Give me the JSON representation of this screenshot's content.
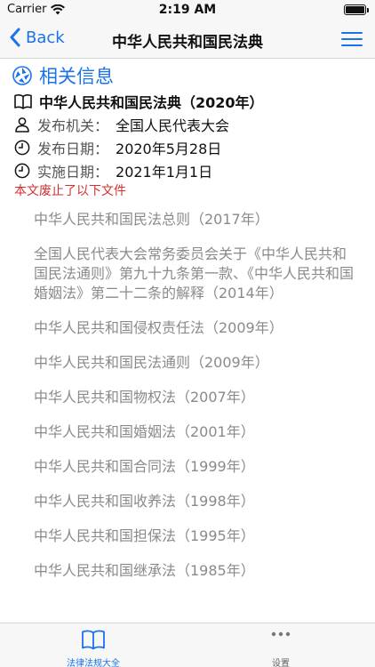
{
  "status_bar": {
    "carrier": "Carrier",
    "time": "2:19 AM",
    "battery_level": 1.0
  },
  "nav": {
    "back_label": "Back",
    "title": "中华人民共和国民法典",
    "menu_icon": "hamburger-menu-icon"
  },
  "section": {
    "title": "相关信息",
    "icon": "aperture-icon",
    "doc_title": "中华人民共和国民法典（2020年）",
    "issuer_label": "发布机关：",
    "issuer_value": "全国人民代表大会",
    "publish_label": "发布日期：",
    "publish_value": "2020年5月28日",
    "effective_label": "实施日期：",
    "effective_value": "2021年1月1日",
    "repeal_note": "本文废止了以下文件"
  },
  "repealed_list": [
    "中华人民共和国民法总则（2017年）",
    "全国人民代表大会常务委员会关于《中华人民共和国民法通则》第九十九条第一款、《中华人民共和国婚姻法》第二十二条的解释（2014年）",
    "中华人民共和国侵权责任法（2009年）",
    "中华人民共和国民法通则（2009年）",
    "中华人民共和国物权法（2007年）",
    "中华人民共和国婚姻法（2001年）",
    "中华人民共和国合同法（1999年）",
    "中华人民共和国收养法（1998年）",
    "中华人民共和国担保法（1995年）",
    "中华人民共和国继承法（1985年）"
  ],
  "tabs": [
    {
      "label": "法律法规大全",
      "icon": "book-icon",
      "active": true
    },
    {
      "label": "设置",
      "icon": "more-dots-icon",
      "active": false
    }
  ],
  "colors": {
    "accent": "#1a73e8",
    "warning": "#d32f2f",
    "muted": "#8a8a8a"
  }
}
